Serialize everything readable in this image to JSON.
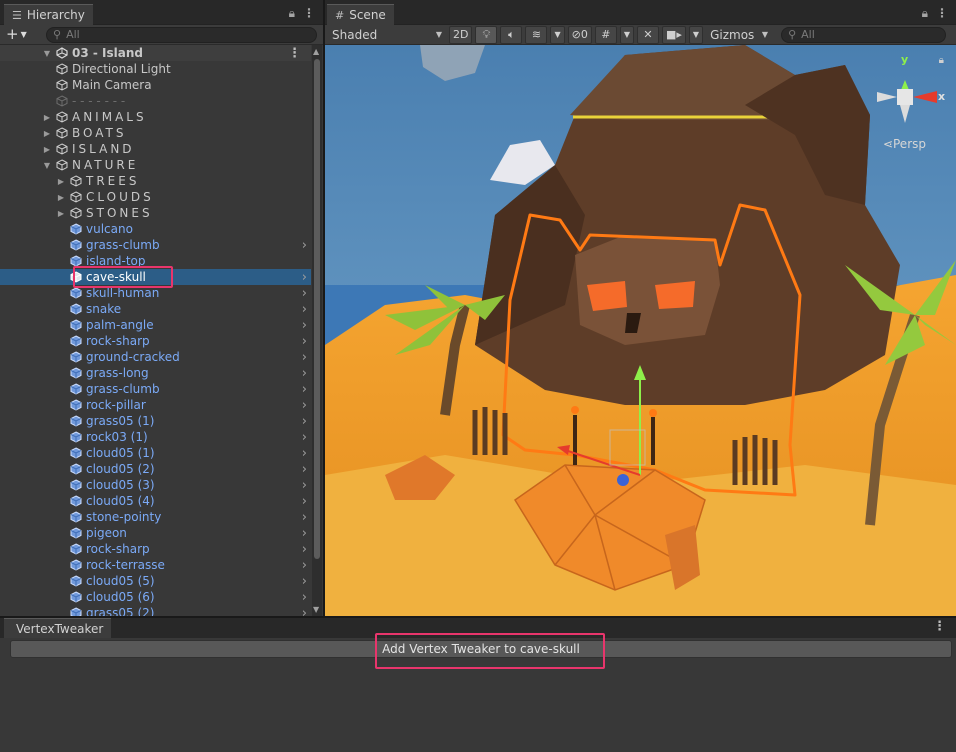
{
  "hierarchy": {
    "tab_label": "Hierarchy",
    "tab_icon": "list-icon",
    "add_label": "+",
    "search_placeholder": "All",
    "scene_name": "03 - Island",
    "items": [
      {
        "label": "Directional Light",
        "depth": 1,
        "kind": "object",
        "fold": "none"
      },
      {
        "label": "Main Camera",
        "depth": 1,
        "kind": "object",
        "fold": "none"
      },
      {
        "label": "- - - - - - -",
        "depth": 1,
        "kind": "dim",
        "fold": "none"
      },
      {
        "label": "ANIMALS",
        "depth": 1,
        "kind": "group",
        "fold": "closed"
      },
      {
        "label": "BOATS",
        "depth": 1,
        "kind": "group",
        "fold": "closed"
      },
      {
        "label": "ISLAND",
        "depth": 1,
        "kind": "group",
        "fold": "closed"
      },
      {
        "label": "NATURE",
        "depth": 1,
        "kind": "group",
        "fold": "open"
      },
      {
        "label": "TREES",
        "depth": 2,
        "kind": "group",
        "fold": "closed"
      },
      {
        "label": "CLOUDS",
        "depth": 2,
        "kind": "group",
        "fold": "closed"
      },
      {
        "label": "STONES",
        "depth": 2,
        "kind": "group",
        "fold": "closed"
      },
      {
        "label": "vulcano",
        "depth": 2,
        "kind": "prefab",
        "fold": "none",
        "arrow": false
      },
      {
        "label": "grass-clumb",
        "depth": 2,
        "kind": "prefab",
        "fold": "none",
        "arrow": true
      },
      {
        "label": "island-top",
        "depth": 2,
        "kind": "prefab",
        "fold": "none",
        "arrow": false
      },
      {
        "label": "cave-skull",
        "depth": 2,
        "kind": "prefab",
        "fold": "none",
        "arrow": true,
        "selected": true
      },
      {
        "label": "skull-human",
        "depth": 2,
        "kind": "prefab",
        "fold": "none",
        "arrow": true
      },
      {
        "label": "snake",
        "depth": 2,
        "kind": "prefab",
        "fold": "none",
        "arrow": true
      },
      {
        "label": "palm-angle",
        "depth": 2,
        "kind": "prefab",
        "fold": "none",
        "arrow": true
      },
      {
        "label": "rock-sharp",
        "depth": 2,
        "kind": "prefab",
        "fold": "none",
        "arrow": true
      },
      {
        "label": "ground-cracked",
        "depth": 2,
        "kind": "prefab",
        "fold": "none",
        "arrow": true
      },
      {
        "label": "grass-long",
        "depth": 2,
        "kind": "prefab",
        "fold": "none",
        "arrow": true
      },
      {
        "label": "grass-clumb",
        "depth": 2,
        "kind": "prefab",
        "fold": "none",
        "arrow": true
      },
      {
        "label": "rock-pillar",
        "depth": 2,
        "kind": "prefab",
        "fold": "none",
        "arrow": true
      },
      {
        "label": "grass05 (1)",
        "depth": 2,
        "kind": "prefab",
        "fold": "none",
        "arrow": true
      },
      {
        "label": "rock03 (1)",
        "depth": 2,
        "kind": "prefab",
        "fold": "none",
        "arrow": true
      },
      {
        "label": "cloud05 (1)",
        "depth": 2,
        "kind": "prefab",
        "fold": "none",
        "arrow": true
      },
      {
        "label": "cloud05 (2)",
        "depth": 2,
        "kind": "prefab",
        "fold": "none",
        "arrow": true
      },
      {
        "label": "cloud05 (3)",
        "depth": 2,
        "kind": "prefab",
        "fold": "none",
        "arrow": true
      },
      {
        "label": "cloud05 (4)",
        "depth": 2,
        "kind": "prefab",
        "fold": "none",
        "arrow": true
      },
      {
        "label": "stone-pointy",
        "depth": 2,
        "kind": "prefab",
        "fold": "none",
        "arrow": true
      },
      {
        "label": "pigeon",
        "depth": 2,
        "kind": "prefab",
        "fold": "none",
        "arrow": true
      },
      {
        "label": "rock-sharp",
        "depth": 2,
        "kind": "prefab",
        "fold": "none",
        "arrow": true
      },
      {
        "label": "rock-terrasse",
        "depth": 2,
        "kind": "prefab",
        "fold": "none",
        "arrow": true
      },
      {
        "label": "cloud05 (5)",
        "depth": 2,
        "kind": "prefab",
        "fold": "none",
        "arrow": true
      },
      {
        "label": "cloud05 (6)",
        "depth": 2,
        "kind": "prefab",
        "fold": "none",
        "arrow": true
      },
      {
        "label": "grass05 (2)",
        "depth": 2,
        "kind": "prefab",
        "fold": "none",
        "arrow": true
      }
    ]
  },
  "scene": {
    "tab_label": "Scene",
    "tab_icon": "grid-icon",
    "shading_mode": "Shaded",
    "mode_2d": "2D",
    "hidden_count": "0",
    "gizmos_label": "Gizmos",
    "search_placeholder": "All",
    "gizmo": {
      "y_label": "y",
      "x_label": "x",
      "projection": "Persp"
    }
  },
  "vertex_tweaker": {
    "tab_label": "VertexTweaker",
    "button_label": "Add Vertex Tweaker to cave-skull"
  },
  "colors": {
    "selection": "#2c5d87",
    "prefab_text": "#7baaf7",
    "annotation": "#e8356c",
    "outline": "#ff7a14"
  }
}
